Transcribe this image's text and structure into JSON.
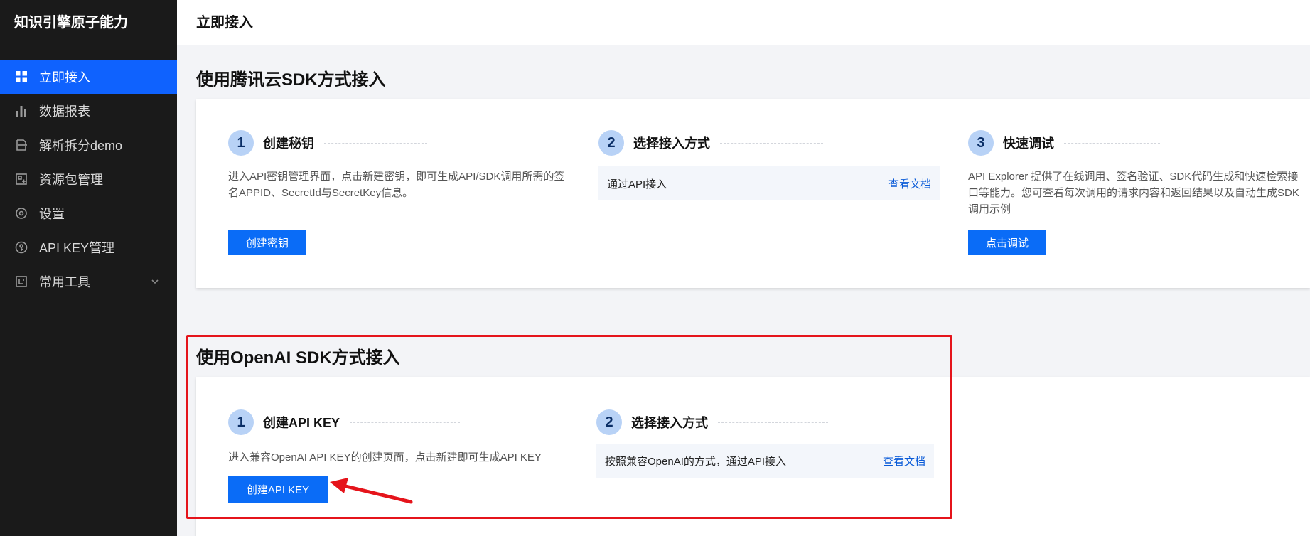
{
  "sidebar": {
    "brand": "知识引擎原子能力",
    "items": [
      {
        "label": "立即接入",
        "icon": "grid-icon"
      },
      {
        "label": "数据报表",
        "icon": "bar-chart-icon"
      },
      {
        "label": "解析拆分demo",
        "icon": "document-split-icon"
      },
      {
        "label": "资源包管理",
        "icon": "package-icon"
      },
      {
        "label": "设置",
        "icon": "settings-icon"
      },
      {
        "label": "API KEY管理",
        "icon": "key-icon"
      },
      {
        "label": "常用工具",
        "icon": "tools-icon"
      }
    ],
    "active_index": 0
  },
  "topbar": {
    "title": "立即接入"
  },
  "tencent_sdk": {
    "title": "使用腾讯云SDK方式接入",
    "steps": [
      {
        "num": "1",
        "title": "创建秘钥",
        "desc": "进入API密钥管理界面，点击新建密钥，即可生成API/SDK调用所需的签名APPID、SecretId与SecretKey信息。",
        "button": "创建密钥"
      },
      {
        "num": "2",
        "title": "选择接入方式",
        "option": "通过API接入",
        "link": "查看文档"
      },
      {
        "num": "3",
        "title": "快速调试",
        "desc": "API Explorer 提供了在线调用、签名验证、SDK代码生成和快速检索接口等能力。您可查看每次调用的请求内容和返回结果以及自动生成SDK调用示例",
        "button": "点击调试"
      }
    ]
  },
  "openai_sdk": {
    "title": "使用OpenAI SDK方式接入",
    "steps": [
      {
        "num": "1",
        "title": "创建API KEY",
        "desc": "进入兼容OpenAI API KEY的创建页面，点击新建即可生成API KEY",
        "button": "创建API KEY"
      },
      {
        "num": "2",
        "title": "选择接入方式",
        "option": "按照兼容OpenAI的方式，通过API接入",
        "link": "查看文档"
      }
    ]
  },
  "colors": {
    "sidebar_bg": "#1a1a1a",
    "active_bg": "#0f62fe",
    "primary_button": "#0a6cf7",
    "link": "#0a5bd8",
    "highlight_border": "#e5141b"
  }
}
